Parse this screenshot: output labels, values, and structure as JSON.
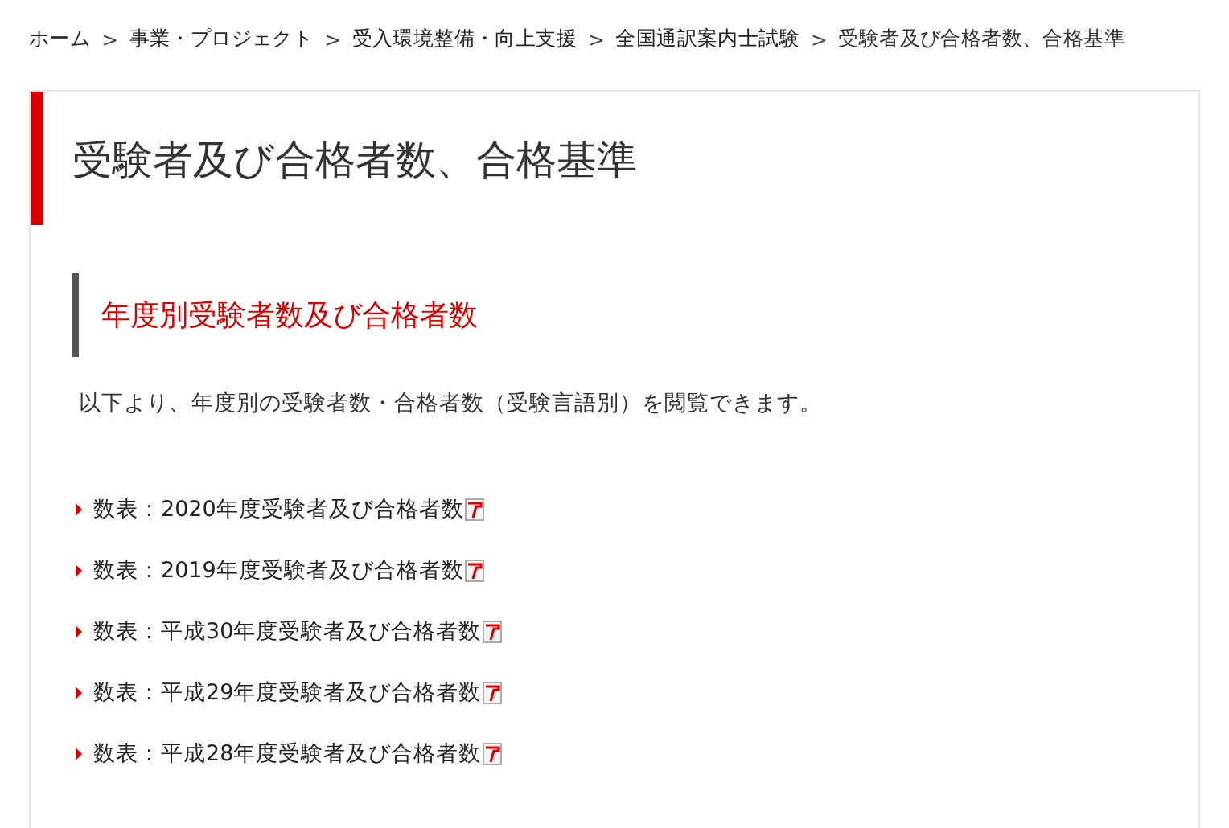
{
  "breadcrumb": {
    "separator": ">",
    "items": [
      "ホーム",
      "事業・プロジェクト",
      "受入環境整備・向上支援",
      "全国通訳案内士試験",
      "受験者及び合格者数、合格基準"
    ]
  },
  "page_title": "受験者及び合格者数、合格基準",
  "section": {
    "heading": "年度別受験者数及び合格者数",
    "description": "以下より、年度別の受験者数・合格者数（受験言語別）を閲覧できます。",
    "links": [
      {
        "label": "数表：2020年度受験者及び合格者数"
      },
      {
        "label": "数表：2019年度受験者及び合格者数"
      },
      {
        "label": "数表：平成30年度受験者及び合格者数"
      },
      {
        "label": "数表：平成29年度受験者及び合格者数"
      },
      {
        "label": "数表：平成28年度受験者及び合格者数"
      }
    ]
  }
}
